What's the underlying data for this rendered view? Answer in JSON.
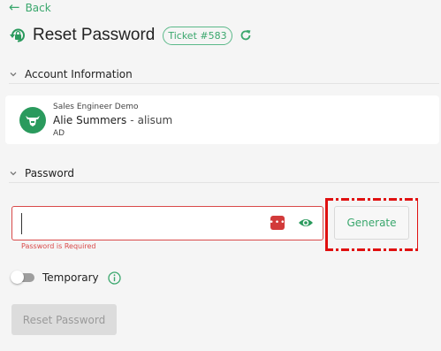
{
  "nav": {
    "back_label": "Back"
  },
  "header": {
    "title": "Reset Password",
    "ticket_badge": "Ticket #583"
  },
  "account_section": {
    "title": "Account Information",
    "org": "Sales Engineer Demo",
    "full_name": "Alie Summers",
    "separator": "-",
    "username": "alisum",
    "directory": "AD"
  },
  "password_section": {
    "title": "Password",
    "input_value": "",
    "error": "Password is Required",
    "generate_label": "Generate",
    "temporary_label": "Temporary",
    "temporary_on": false,
    "submit_label": "Reset Password"
  },
  "colors": {
    "accent": "#3aa76d",
    "error": "#d94a4a",
    "highlight": "#e01010"
  },
  "icons": [
    "back-arrow-icon",
    "lock-reset-icon",
    "refresh-icon",
    "chevron-down-icon",
    "avatar-icon",
    "password-manager-icon",
    "eye-icon",
    "info-icon"
  ]
}
